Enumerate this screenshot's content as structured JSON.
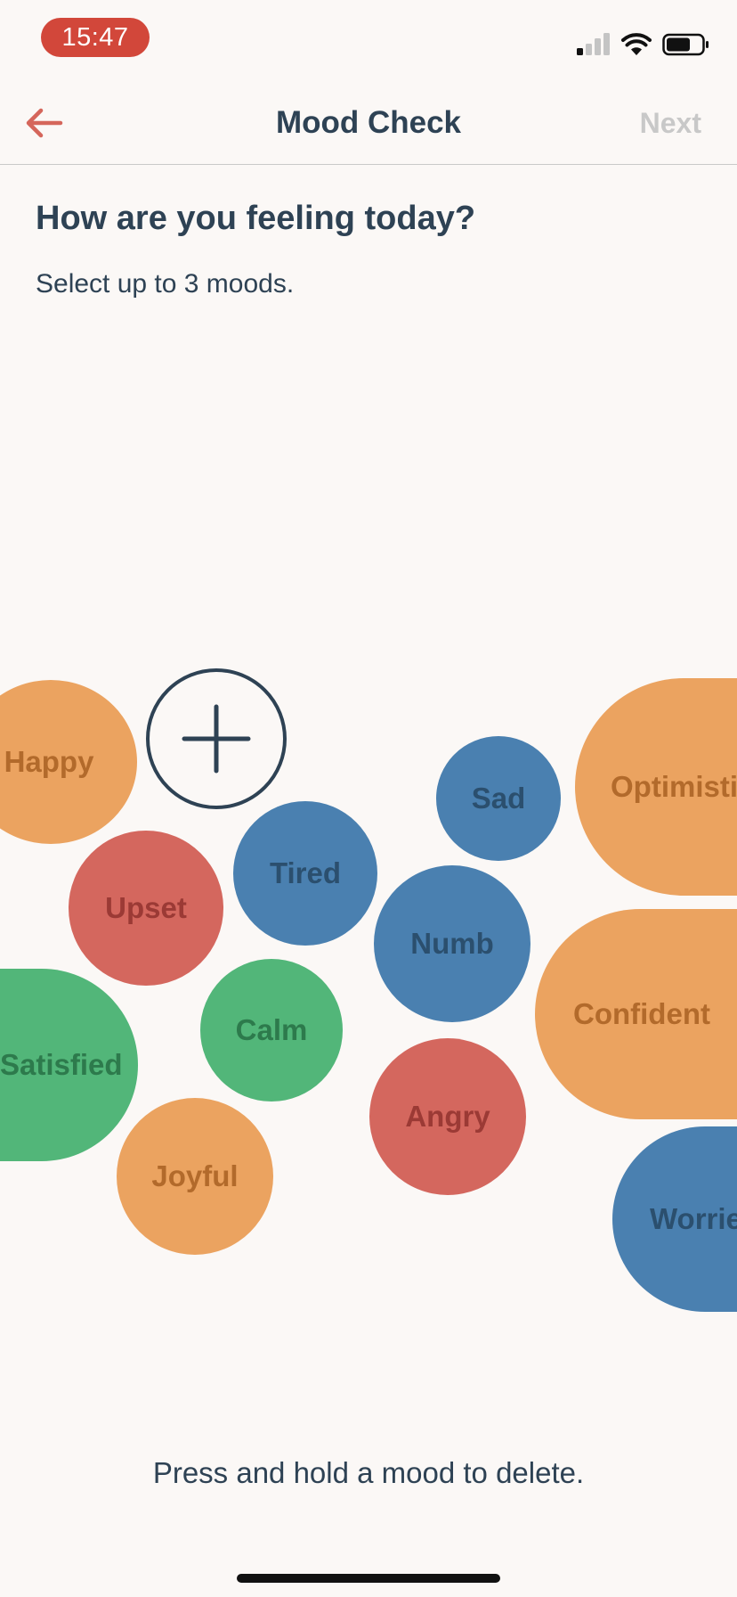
{
  "status_bar": {
    "time": "15:47",
    "time_pill_color": "#D2473A",
    "icons": [
      "cellular-signal-icon",
      "wifi-icon",
      "battery-icon"
    ]
  },
  "nav": {
    "back_icon": "arrow-left-icon",
    "title": "Mood Check",
    "next_label": "Next",
    "next_enabled": false
  },
  "prompt": {
    "question": "How are you feeling today?",
    "instruction": "Select up to 3 moods."
  },
  "add_mood": {
    "icon": "plus-icon"
  },
  "mood_colors": {
    "orange": "#EBA360",
    "blue": "#4A80B0",
    "red": "#D4675E",
    "green": "#52B679"
  },
  "moods": [
    {
      "label": "Happy",
      "color": "orange"
    },
    {
      "label": "Sad",
      "color": "blue"
    },
    {
      "label": "Optimistic",
      "color": "orange"
    },
    {
      "label": "Tired",
      "color": "blue"
    },
    {
      "label": "Upset",
      "color": "red"
    },
    {
      "label": "Numb",
      "color": "blue"
    },
    {
      "label": "Confident",
      "color": "orange"
    },
    {
      "label": "Calm",
      "color": "green"
    },
    {
      "label": "Satisfied",
      "color": "green"
    },
    {
      "label": "Angry",
      "color": "red"
    },
    {
      "label": "Joyful",
      "color": "orange"
    },
    {
      "label": "Worried",
      "color": "blue"
    }
  ],
  "footer": {
    "hint": "Press and hold a mood to delete."
  }
}
